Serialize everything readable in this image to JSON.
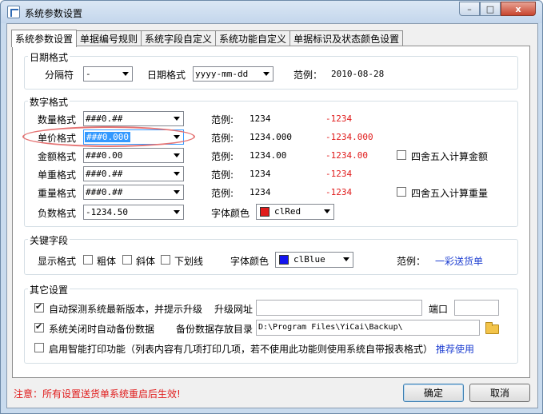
{
  "window": {
    "title": "系统参数设置",
    "minimize": "–",
    "maximize": "□",
    "close": "x"
  },
  "tabs": [
    "系统参数设置",
    "单据编号规则",
    "系统字段自定义",
    "系统功能自定义",
    "单据标识及状态颜色设置"
  ],
  "date_group": {
    "title": "日期格式",
    "separator_label": "分隔符",
    "separator_value": "-",
    "format_label": "日期格式",
    "format_value": "yyyy-mm-dd",
    "example_label": "范例：",
    "example_value": "2010-08-28"
  },
  "number_group": {
    "title": "数字格式",
    "example_label": "范例:",
    "rows": [
      {
        "label": "数量格式",
        "format": "###0.##",
        "example": "1234",
        "negative": "-1234"
      },
      {
        "label": "单价格式",
        "format": "###0.000",
        "example": "1234.000",
        "negative": "-1234.000"
      },
      {
        "label": "金额格式",
        "format": "###0.00",
        "example": "1234.00",
        "negative": "-1234.00"
      },
      {
        "label": "单重格式",
        "format": "###0.##",
        "example": "1234",
        "negative": "-1234"
      },
      {
        "label": "重量格式",
        "format": "###0.##",
        "example": "1234",
        "negative": "-1234"
      }
    ],
    "negative_label": "负数格式",
    "negative_value": "-1234.50",
    "font_color_label": "字体颜色",
    "font_color_value": "clRed",
    "font_color_hex": "#e01b1b",
    "round_amount_label": "四舍五入计算金额",
    "round_weight_label": "四舍五入计算重量"
  },
  "key_group": {
    "title": "关键字段",
    "display_label": "显示格式",
    "bold": "粗体",
    "italic": "斜体",
    "underline": "下划线",
    "font_color_label": "字体颜色",
    "font_color_value": "clBlue",
    "font_color_hex": "#1414f0",
    "example_label": "范例：",
    "example_value": "一彩送货单"
  },
  "other_group": {
    "title": "其它设置",
    "auto_update_label": "自动探测系统最新版本，并提示升级",
    "update_url_label": "升级网址",
    "update_url_value": "",
    "port_label": "端口",
    "port_value": "",
    "auto_backup_label": "系统关闭时自动备份数据",
    "backup_dir_label": "备份数据存放目录",
    "backup_dir_value": "D:\\Program Files\\YiCai\\Backup\\",
    "smart_print_label": "启用智能打印功能（列表内容有几项打印几项，若不使用此功能则使用系统自带报表格式）",
    "recommend_label": "推荐使用"
  },
  "footer": {
    "note": "注意：所有设置送货单系统重启后生效!",
    "ok": "确定",
    "cancel": "取消"
  }
}
